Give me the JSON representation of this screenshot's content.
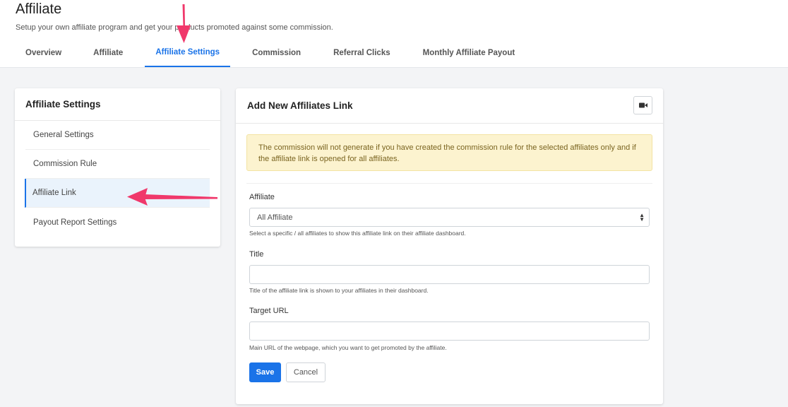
{
  "header": {
    "title": "Affiliate",
    "subtitle": "Setup your own affiliate program and get your products promoted against some commission."
  },
  "tabs": [
    {
      "label": "Overview",
      "active": false
    },
    {
      "label": "Affiliate",
      "active": false
    },
    {
      "label": "Affiliate Settings",
      "active": true
    },
    {
      "label": "Commission",
      "active": false
    },
    {
      "label": "Referral Clicks",
      "active": false
    },
    {
      "label": "Monthly Affiliate Payout",
      "active": false
    }
  ],
  "sidebar": {
    "title": "Affiliate Settings",
    "items": [
      {
        "label": "General Settings",
        "active": false
      },
      {
        "label": "Commission Rule",
        "active": false
      },
      {
        "label": "Affiliate Link",
        "active": true
      },
      {
        "label": "Payout Report Settings",
        "active": false
      }
    ]
  },
  "main": {
    "title": "Add New Affiliates Link",
    "video_icon": "video-camera-icon",
    "alert_text": "The commission will not generate if you have created the commission rule for the selected affiliates only and if the affiliate link is opened for all affiliates.",
    "affiliate_label": "Affiliate",
    "affiliate_value": "All Affiliate",
    "affiliate_help": "Select a specific / all affiliates to show this affiliate link on their affiliate dashboard.",
    "title_label": "Title",
    "title_value": "",
    "title_help": "Title of the affiliate link is shown to your affiliates in their dashboard.",
    "url_label": "Target URL",
    "url_value": "",
    "url_help": "Main URL of the webpage, which you want to get promoted by the affiliate.",
    "save_label": "Save",
    "cancel_label": "Cancel"
  },
  "colors": {
    "accent": "#1a73e8",
    "annotation_arrow": "#f0386b",
    "alert_bg": "#fcf3cf"
  }
}
